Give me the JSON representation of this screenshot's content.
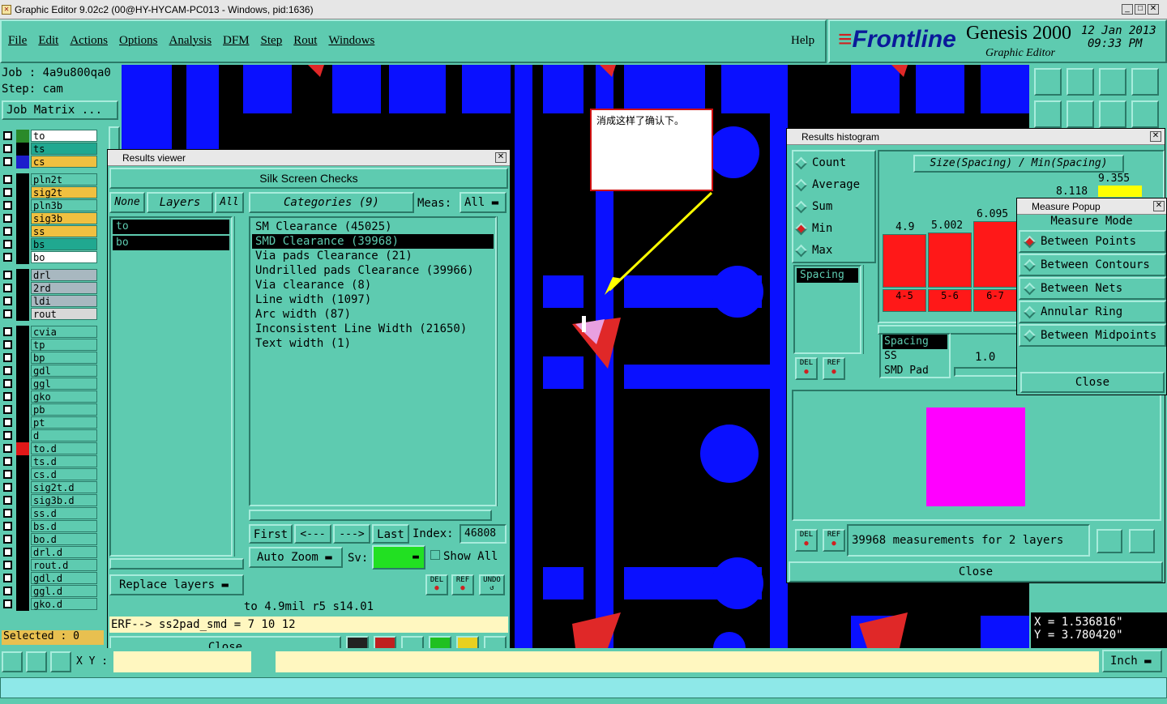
{
  "window": {
    "title": "Graphic Editor 9.02c2 (00@HY-HYCAM-PC013 - Windows, pid:1636)"
  },
  "menu": [
    "File",
    "Edit",
    "Actions",
    "Options",
    "Analysis",
    "DFM",
    "Step",
    "Rout",
    "Windows"
  ],
  "help": "Help",
  "brand": {
    "logo": "Frontline",
    "product": "Genesis 2000",
    "subtitle": "Graphic Editor",
    "date": "12 Jan 2013",
    "time": "09:33 PM"
  },
  "job": {
    "job": "Job : 4a9u800qa0",
    "step": "Step: cam",
    "matrix": "Job Matrix ..."
  },
  "layers": [
    {
      "name": "to",
      "color": "#ffffff",
      "sq": "#2a8a2a"
    },
    {
      "name": "ts",
      "color": "#20a890",
      "sq": ""
    },
    {
      "name": "cs",
      "color": "#f0c040",
      "sq": "#1d1dcc"
    },
    {
      "name": "pln2t",
      "color": "#5ecbb0",
      "sq": ""
    },
    {
      "name": "sig2t",
      "color": "#f0c040",
      "sq": ""
    },
    {
      "name": "pln3b",
      "color": "#5ecbb0",
      "sq": ""
    },
    {
      "name": "sig3b",
      "color": "#f0c040",
      "sq": ""
    },
    {
      "name": "ss",
      "color": "#f0c040",
      "sq": ""
    },
    {
      "name": "bs",
      "color": "#20a890",
      "sq": ""
    },
    {
      "name": "bo",
      "color": "#ffffff",
      "sq": ""
    },
    {
      "name": "drl",
      "color": "#a8b8c0",
      "sq": ""
    },
    {
      "name": "2rd",
      "color": "#a8b8c0",
      "sq": ""
    },
    {
      "name": "ldi",
      "color": "#a8b8c0",
      "sq": ""
    },
    {
      "name": "rout",
      "color": "#d8d8d8",
      "sq": ""
    },
    {
      "name": "cvia",
      "color": "#5ecbb0",
      "sq": ""
    },
    {
      "name": "tp",
      "color": "#5ecbb0",
      "sq": ""
    },
    {
      "name": "bp",
      "color": "#5ecbb0",
      "sq": ""
    },
    {
      "name": "gdl",
      "color": "#5ecbb0",
      "sq": ""
    },
    {
      "name": "ggl",
      "color": "#5ecbb0",
      "sq": ""
    },
    {
      "name": "gko",
      "color": "#5ecbb0",
      "sq": ""
    },
    {
      "name": "pb",
      "color": "#5ecbb0",
      "sq": ""
    },
    {
      "name": "pt",
      "color": "#5ecbb0",
      "sq": ""
    },
    {
      "name": "d",
      "color": "#5ecbb0",
      "sq": ""
    },
    {
      "name": "to.d",
      "color": "#5ecbb0",
      "sq": "#e01818"
    },
    {
      "name": "ts.d",
      "color": "#5ecbb0",
      "sq": ""
    },
    {
      "name": "cs.d",
      "color": "#5ecbb0",
      "sq": ""
    },
    {
      "name": "sig2t.d",
      "color": "#5ecbb0",
      "sq": ""
    },
    {
      "name": "sig3b.d",
      "color": "#5ecbb0",
      "sq": ""
    },
    {
      "name": "ss.d",
      "color": "#5ecbb0",
      "sq": ""
    },
    {
      "name": "bs.d",
      "color": "#5ecbb0",
      "sq": ""
    },
    {
      "name": "bo.d",
      "color": "#5ecbb0",
      "sq": ""
    },
    {
      "name": "drl.d",
      "color": "#5ecbb0",
      "sq": ""
    },
    {
      "name": "rout.d",
      "color": "#5ecbb0",
      "sq": ""
    },
    {
      "name": "gdl.d",
      "color": "#5ecbb0",
      "sq": ""
    },
    {
      "name": "ggl.d",
      "color": "#5ecbb0",
      "sq": ""
    },
    {
      "name": "gko.d",
      "color": "#5ecbb0",
      "sq": ""
    }
  ],
  "selected": "Selected : 0",
  "xy_label": "X Y :",
  "note": "消成这样了确认下。",
  "results_viewer": {
    "title": "Results viewer",
    "heading": "Silk Screen Checks",
    "none": "None",
    "layers": "Layers",
    "all": "All",
    "categories": "Categories (9)",
    "meas": "Meas:",
    "meas_val": "All",
    "layer_list": [
      "to",
      "bo"
    ],
    "items": [
      "SM Clearance (45025)",
      "SMD Clearance (39968)",
      "Via pads Clearance (21)",
      "Undrilled pads Clearance (39966)",
      "Via clearance (8)",
      "Line width (1097)",
      "Arc width (87)",
      "Inconsistent Line Width (21650)",
      "Text width (1)"
    ],
    "first": "First",
    "prev": "<---",
    "next": "--->",
    "last": "Last",
    "index_label": "Index:",
    "index": "46808",
    "auto_zoom": "Auto Zoom",
    "sv": "Sv:",
    "show_all": "Show All",
    "replace": "Replace layers",
    "del": "DEL",
    "ref": "REF",
    "undo": "UNDO",
    "status1": "to 4.9mil  r5  s14.01",
    "status2": "ERF--> ss2pad_smd = 7 10 12",
    "close": "Close"
  },
  "histogram": {
    "title": "Results histogram",
    "modes": [
      "Count",
      "Average",
      "Sum",
      "Min",
      "Max"
    ],
    "selected_mode": "Min",
    "ratio": "Size(Spacing) / Min(Spacing)",
    "left_list": [
      "Spacing"
    ],
    "bars": [
      {
        "label": "4.9",
        "bin": "4-5"
      },
      {
        "label": "5.002",
        "bin": "5-6"
      },
      {
        "label": "6.095",
        "bin": "6-7"
      }
    ],
    "top_labels": [
      "9.355",
      "8.118"
    ],
    "types": [
      "Spacing",
      "SS",
      "SMD Pad"
    ],
    "scale": "1.0",
    "del": "DEL",
    "ref": "REF",
    "measurements": "39968 measurements for 2 layers",
    "close": "Close"
  },
  "measure": {
    "title": "Measure Popup",
    "heading": "Measure Mode",
    "options": [
      "Between Points",
      "Between Contours",
      "Between Nets",
      "Annular Ring",
      "Between Midpoints"
    ],
    "selected": "Between Points",
    "close": "Close"
  },
  "coords": {
    "x": "X = 1.536816\"",
    "y": "Y = 3.780420\""
  },
  "units": "Inch"
}
